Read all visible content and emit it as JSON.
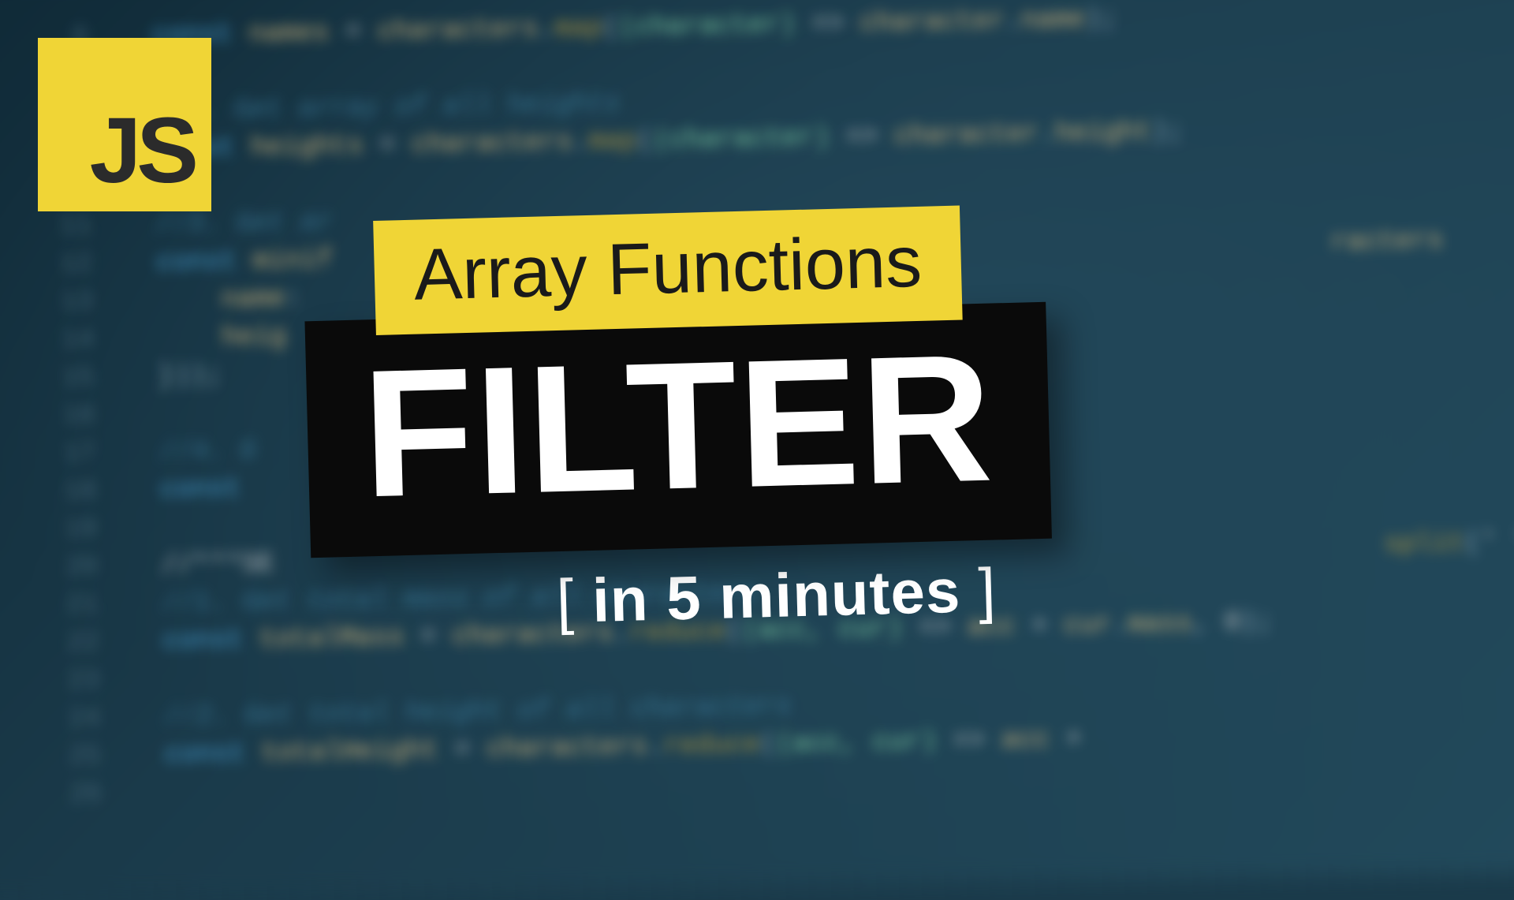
{
  "badge": {
    "label": "JS"
  },
  "title": {
    "line1": "Array Functions",
    "line2": "FILTER",
    "subtitle_open": "[",
    "subtitle_text": " in 5 minutes ",
    "subtitle_close": "]"
  },
  "colors": {
    "accent_yellow": "#f0d536",
    "dark": "#0a0a0a",
    "bg": "#1a3a4a"
  },
  "background_code_hint": "blurred JavaScript code editor with const declarations, characters.map, characters.reduce, comments like 'Get array of all heights', 'Get total mass of all characters', 'Get total height of all characters'"
}
